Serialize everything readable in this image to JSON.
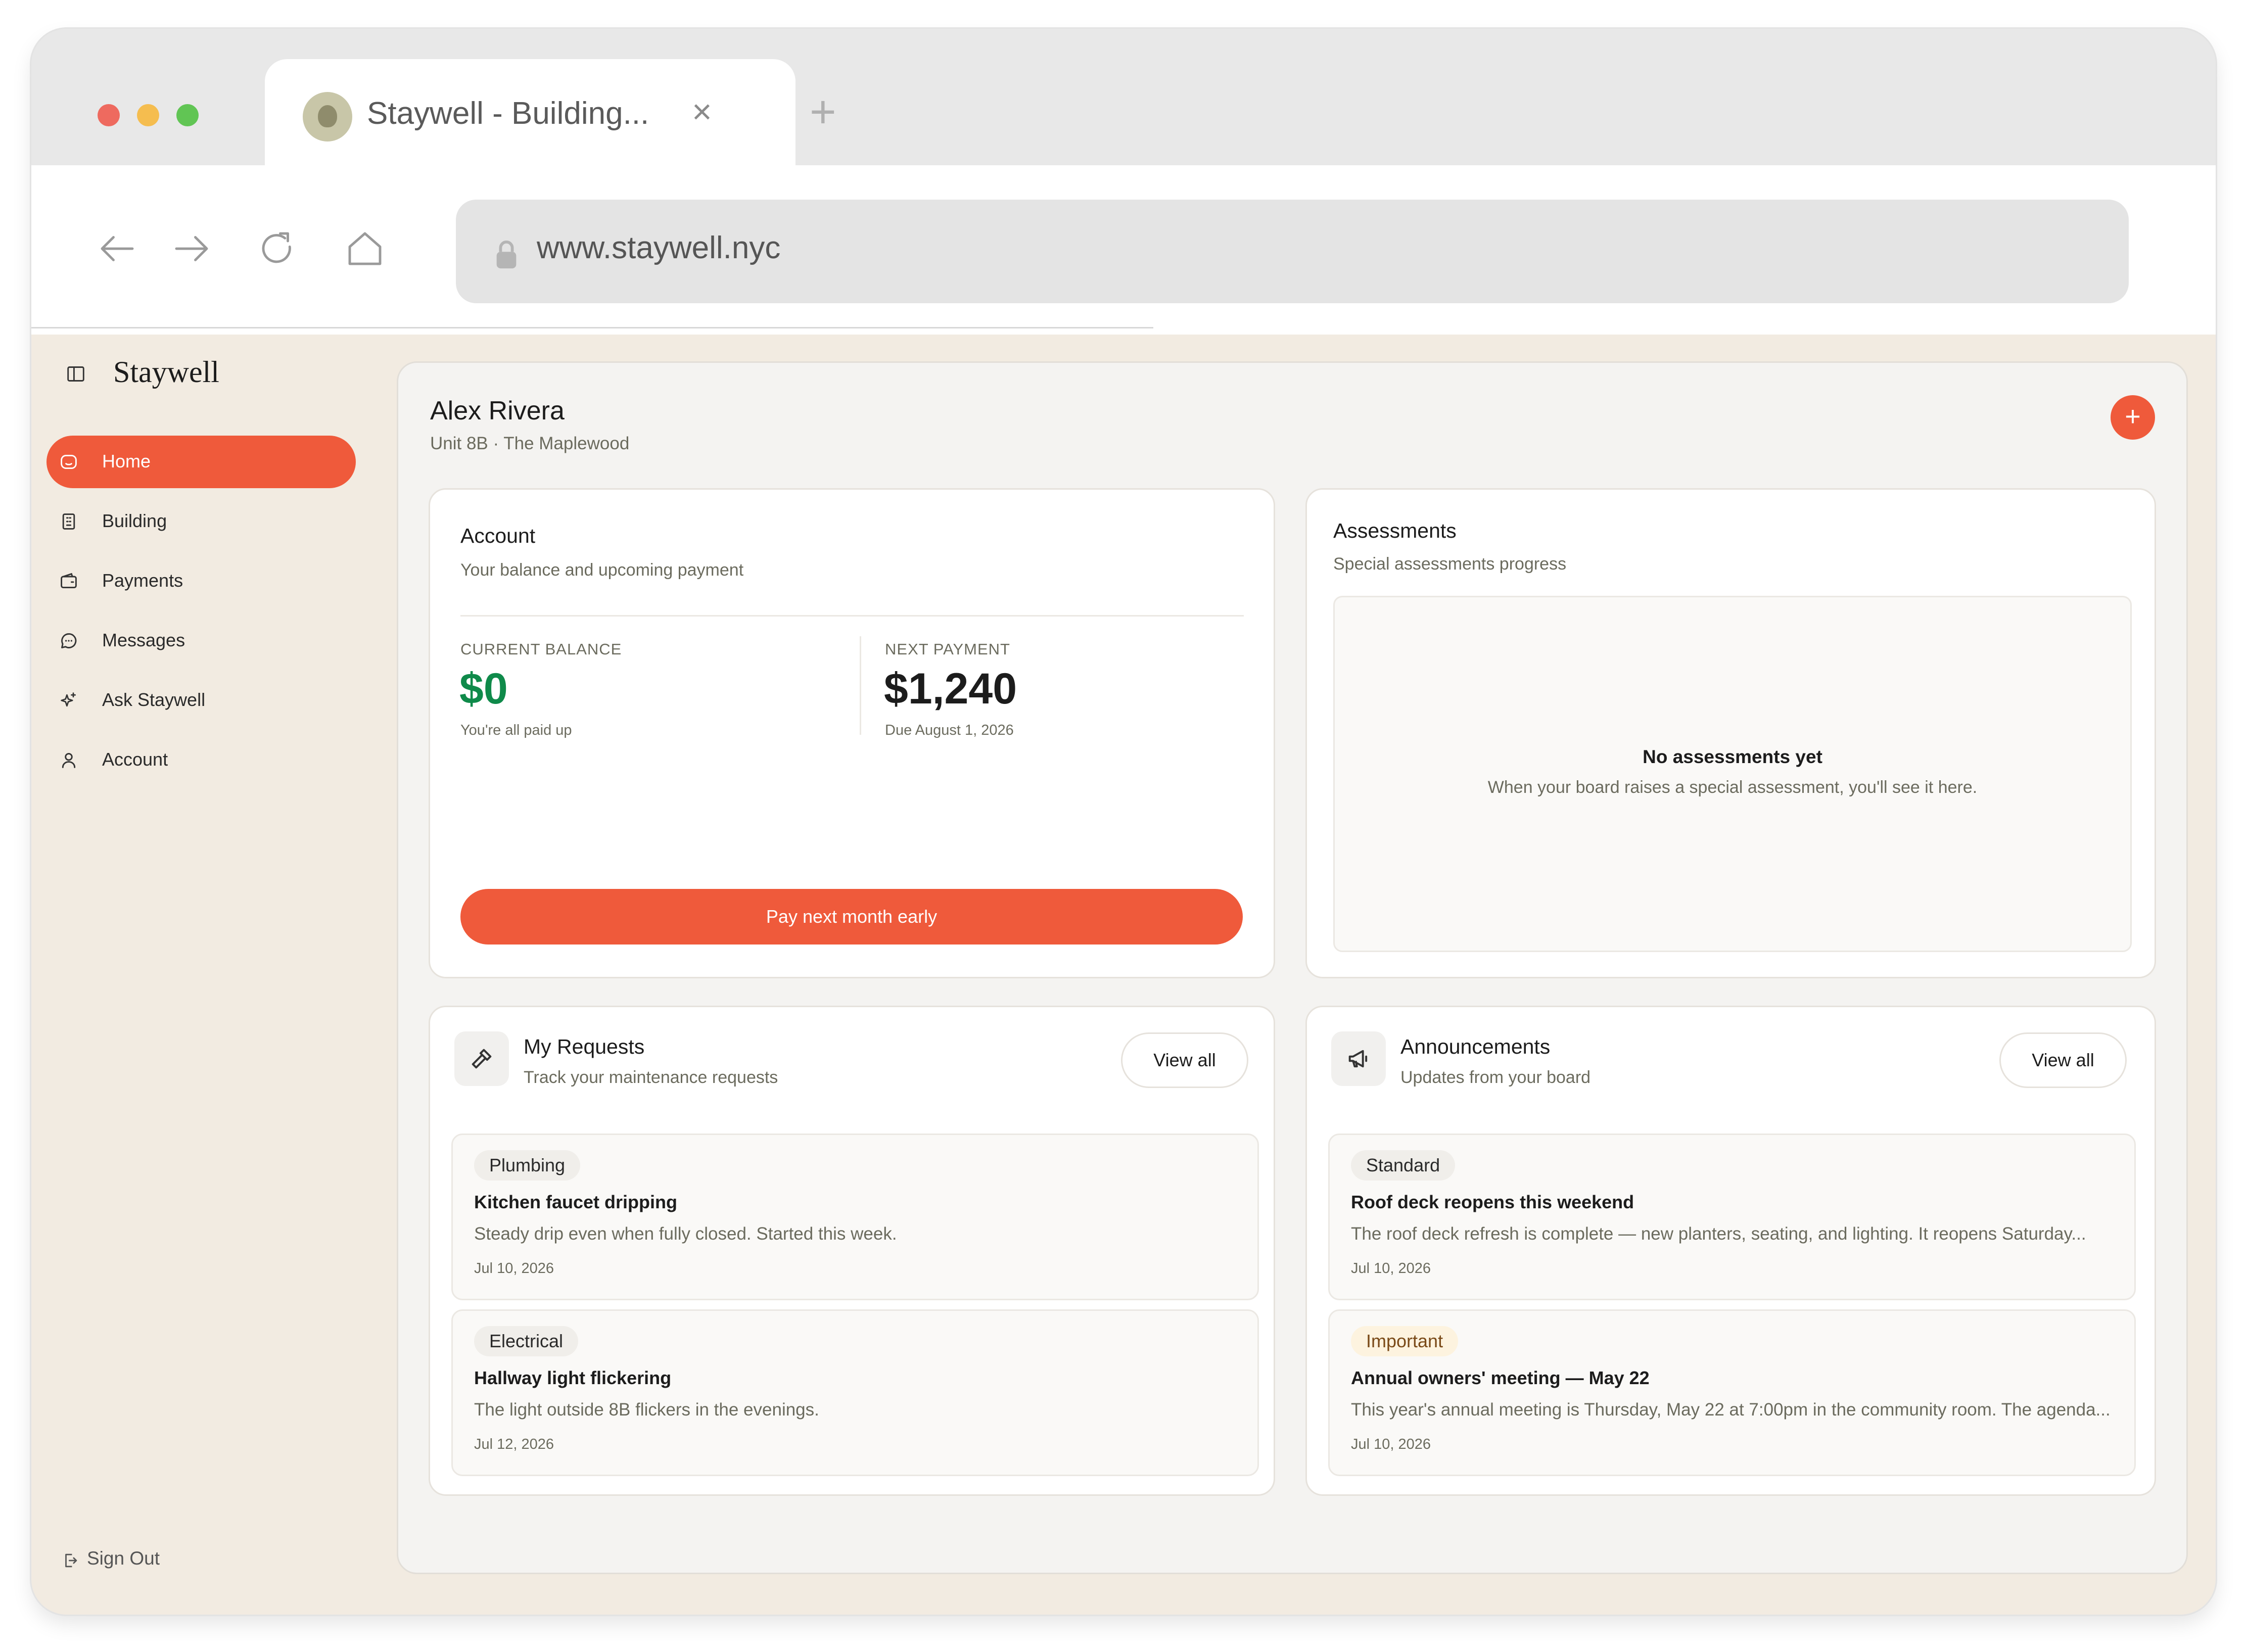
{
  "browser": {
    "tab_title": "Staywell - Building...",
    "url": "www.staywell.nyc",
    "new_tab_symbol": "+",
    "close_symbol": "×",
    "traffic_lights": {
      "close": "#ee6a5f",
      "minimize": "#f5bd4f",
      "zoom": "#61c554"
    }
  },
  "sidebar": {
    "brand": "Staywell",
    "items": [
      {
        "label": "Home",
        "icon": "home-icon"
      },
      {
        "label": "Building",
        "icon": "building-icon"
      },
      {
        "label": "Payments",
        "icon": "wallet-icon"
      },
      {
        "label": "Messages",
        "icon": "chat-bubble-icon"
      },
      {
        "label": "Ask Staywell",
        "icon": "sparkles-icon"
      },
      {
        "label": "Account",
        "icon": "user-icon"
      }
    ],
    "active_item": "Home",
    "sign_out": "Sign Out"
  },
  "header": {
    "name": "Alex Rivera",
    "unit": "Unit 8B · The Maplewood",
    "add_symbol": "+"
  },
  "account_card": {
    "title": "Account",
    "subtitle": "Your balance and upcoming payment",
    "current_balance_label": "CURRENT BALANCE",
    "current_balance_value": "$0",
    "current_balance_note": "You're all paid up",
    "next_payment_label": "NEXT PAYMENT",
    "next_payment_value": "$1,240",
    "next_payment_note": "Due August 1, 2026",
    "pay_button": "Pay next month early"
  },
  "assessments_card": {
    "title": "Assessments",
    "subtitle": "Special assessments progress",
    "empty_title": "No assessments yet",
    "empty_subtitle": "When your board raises a special assessment, you'll see it here."
  },
  "requests_card": {
    "title": "My Requests",
    "subtitle": "Track your maintenance requests",
    "view_all": "View all",
    "items": [
      {
        "tag": "Plumbing",
        "title": "Kitchen faucet dripping",
        "description": "Steady drip even when fully closed. Started this week.",
        "date": "Jul 10, 2026"
      },
      {
        "tag": "Electrical",
        "title": "Hallway light flickering",
        "description": "The light outside 8B flickers in the evenings.",
        "date": "Jul 12, 2026"
      }
    ]
  },
  "announcements_card": {
    "title": "Announcements",
    "subtitle": "Updates from your board",
    "view_all": "View all",
    "items": [
      {
        "tag": "Standard",
        "title": "Roof deck reopens this weekend",
        "description": "The roof deck refresh is complete — new planters, seating, and lighting. It reopens Saturday...",
        "date": "Jul 10, 2026"
      },
      {
        "tag": "Important",
        "title": "Annual owners' meeting — May 22",
        "description": "This year's annual meeting is Thursday, May 22 at 7:00pm in the community room. The agenda...",
        "date": "Jul 10, 2026"
      }
    ]
  },
  "colors": {
    "accent": "#ef5a3b",
    "positive": "#0f8a4a",
    "app_background": "#f2ebe1",
    "important_chip": "#fdf3df"
  }
}
